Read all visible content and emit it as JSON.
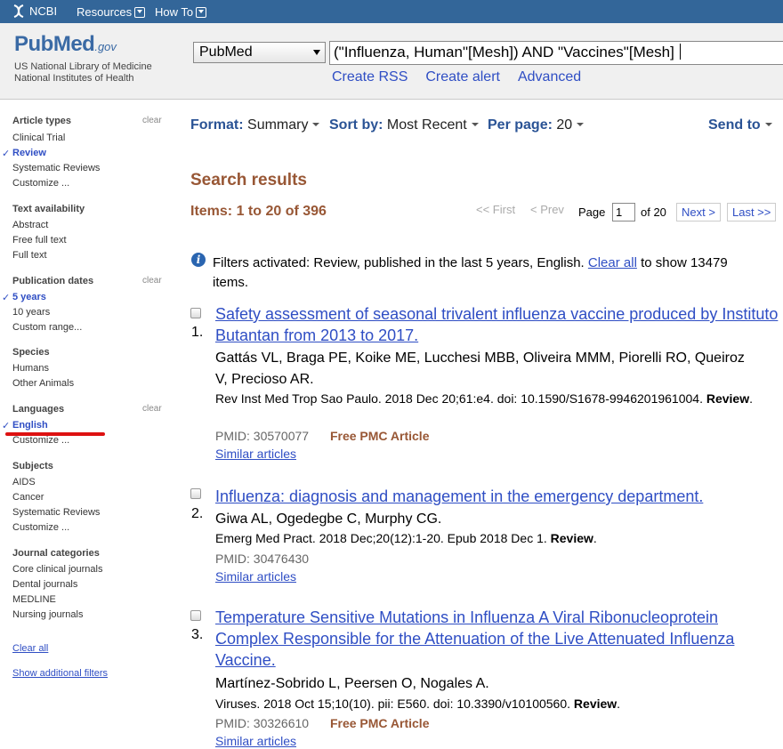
{
  "ncbi": {
    "logo": "NCBI",
    "resources": "Resources",
    "howto": "How To"
  },
  "header": {
    "logo_word": "PubMed",
    "logo_gov": ".gov",
    "line1": "US National Library of Medicine",
    "line2": "National Institutes of Health",
    "database": "PubMed",
    "query": "(\"Influenza, Human\"[Mesh]) AND \"Vaccines\"[Mesh]",
    "links": [
      "Create RSS",
      "Create alert",
      "Advanced"
    ]
  },
  "sidebar": {
    "clear_label": "clear",
    "article_types": {
      "head": "Article types",
      "items": [
        "Clinical Trial",
        "Review",
        "Systematic Reviews",
        "Customize ..."
      ]
    },
    "text_availability": {
      "head": "Text availability",
      "items": [
        "Abstract",
        "Free full text",
        "Full text"
      ]
    },
    "publication_dates": {
      "head": "Publication dates",
      "items": [
        "5 years",
        "10 years",
        "Custom range..."
      ]
    },
    "species": {
      "head": "Species",
      "items": [
        "Humans",
        "Other Animals"
      ]
    },
    "languages": {
      "head": "Languages",
      "items": [
        "English",
        "Customize ..."
      ]
    },
    "subjects": {
      "head": "Subjects",
      "items": [
        "AIDS",
        "Cancer",
        "Systematic Reviews",
        "Customize ..."
      ]
    },
    "journal_categories": {
      "head": "Journal categories",
      "items": [
        "Core clinical journals",
        "Dental journals",
        "MEDLINE",
        "Nursing journals"
      ]
    },
    "clear_all": "Clear all",
    "show_additional": "Show additional filters"
  },
  "toolbar": {
    "format_key": "Format",
    "format_val": "Summary",
    "sort_key": "Sort by",
    "sort_val": "Most Recent",
    "perpage_key": "Per page",
    "perpage_val": "20",
    "send_to": "Send to"
  },
  "results": {
    "title": "Search results",
    "items_count": "Items: 1 to 20 of 396",
    "pager": {
      "first": "<< First",
      "prev": "< Prev",
      "page_label": "Page",
      "page_value": "1",
      "of": "of 20",
      "next": "Next >",
      "last": "Last >>"
    },
    "filters_msg_prefix": "Filters activated: Review, published in the last 5 years, English.",
    "filters_clear": "Clear all",
    "filters_msg_suffix": "to show 13479 items.",
    "items": [
      {
        "num": "1.",
        "title": "Safety assessment of seasonal trivalent influenza vaccine produced by Instituto Butantan from 2013 to 2017.",
        "authors": "Gattás VL, Braga PE, Koike ME, Lucchesi MBB, Oliveira MMM, Piorelli RO, Queiroz V, Precioso AR.",
        "cite": "Rev Inst Med Trop Sao Paulo. 2018 Dec 20;61:e4. doi: 10.1590/S1678-9946201961004.",
        "cite_bold": "Review",
        "pmid": "PMID: 30570077",
        "pmc": "Free PMC Article",
        "similar": "Similar articles"
      },
      {
        "num": "2.",
        "title": "Influenza: diagnosis and management in the emergency department.",
        "authors": "Giwa AL, Ogedegbe C, Murphy CG.",
        "cite": "Emerg Med Pract. 2018 Dec;20(12):1-20. Epub 2018 Dec 1.",
        "cite_bold": "Review",
        "pmid": "PMID: 30476430",
        "pmc": "",
        "similar": "Similar articles"
      },
      {
        "num": "3.",
        "title": "Temperature Sensitive Mutations in Influenza A Viral Ribonucleoprotein Complex Responsible for the Attenuation of the Live Attenuated Influenza Vaccine.",
        "authors": "Martínez-Sobrido L, Peersen O, Nogales A.",
        "cite": "Viruses. 2018 Oct 15;10(10). pii: E560. doi: 10.3390/v10100560.",
        "cite_bold": "Review",
        "pmid": "PMID: 30326610",
        "pmc": "Free PMC Article",
        "similar": "Similar articles"
      }
    ]
  }
}
